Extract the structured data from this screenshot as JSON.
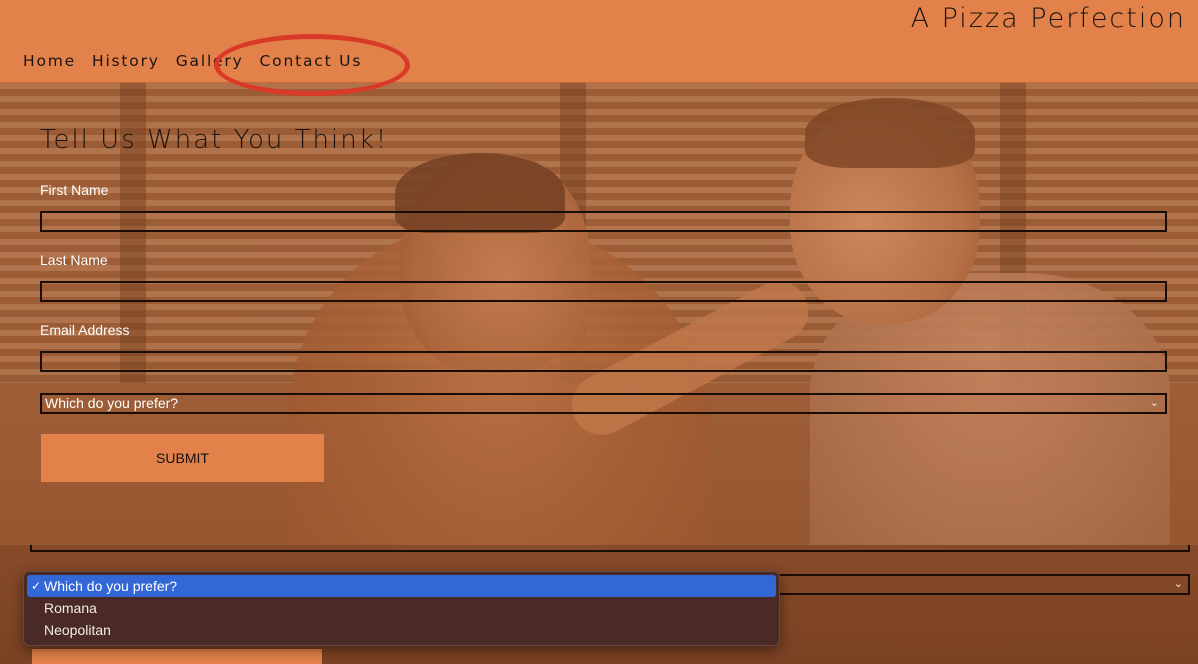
{
  "header": {
    "site_title": "A Pizza Perfection",
    "nav": [
      "Home",
      "History",
      "Gallery",
      "Contact Us"
    ],
    "highlighted_nav": "Contact Us",
    "background_color": "#e2824a",
    "annotation_color": "#d93a27"
  },
  "form": {
    "title": "Tell Us What You Think!",
    "fields": [
      {
        "label": "First Name",
        "value": ""
      },
      {
        "label": "Last Name",
        "value": ""
      },
      {
        "label": "Email Address",
        "value": ""
      }
    ],
    "select": {
      "selected": "Which do you prefer?",
      "options": [
        "Which do you prefer?",
        "Romana",
        "Neopolitan"
      ]
    },
    "submit_label": "SUBMIT"
  },
  "dropdown": {
    "check_glyph": "✓",
    "highlight_color": "#3367d6"
  },
  "icons": {
    "chevron": "chevron-down-icon"
  }
}
